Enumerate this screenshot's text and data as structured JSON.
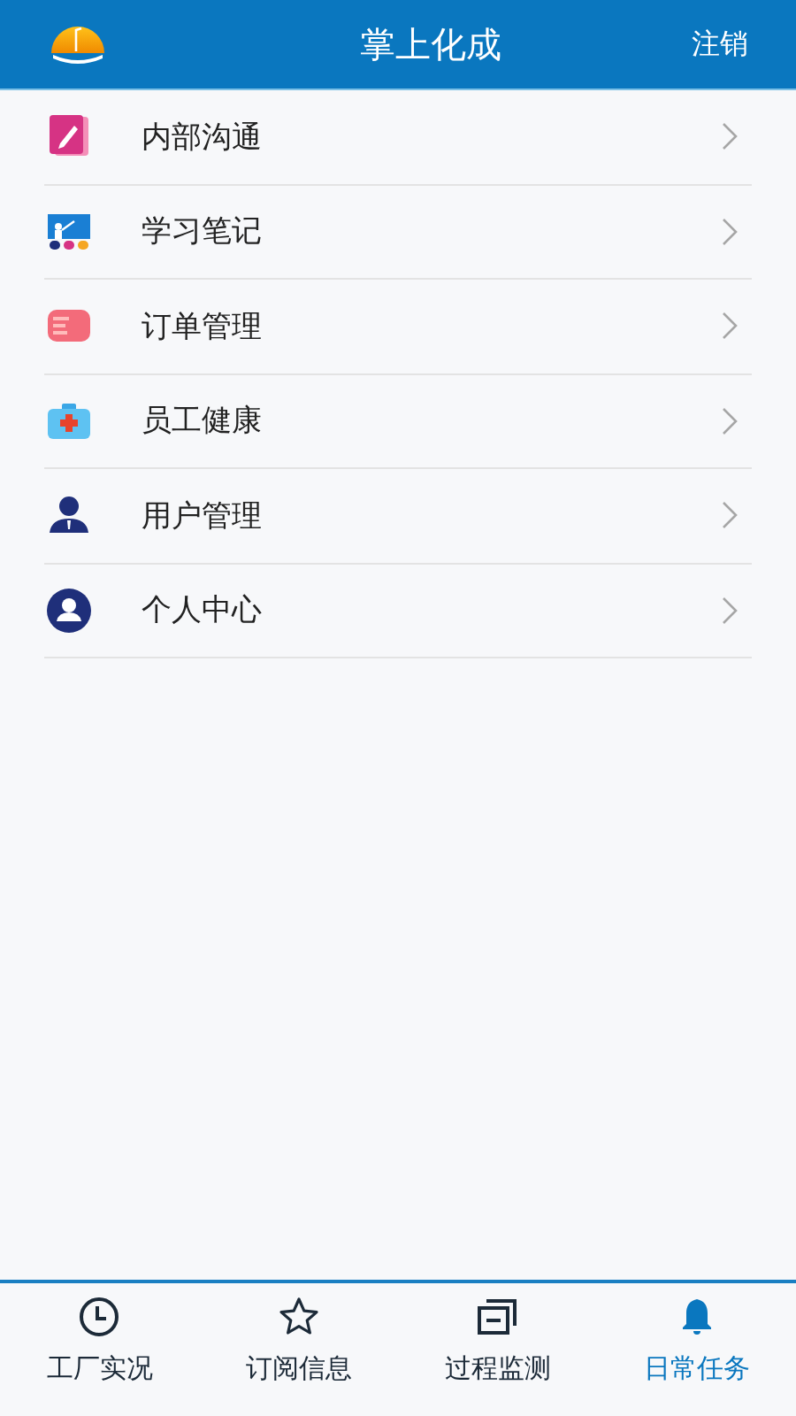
{
  "header": {
    "title": "掌上化成",
    "action": "注销"
  },
  "menu": [
    {
      "label": "内部沟通"
    },
    {
      "label": "学习笔记"
    },
    {
      "label": "订单管理"
    },
    {
      "label": "员工健康"
    },
    {
      "label": "用户管理"
    },
    {
      "label": "个人中心"
    }
  ],
  "tabs": [
    {
      "label": "工厂实况",
      "selected": false
    },
    {
      "label": "订阅信息",
      "selected": false
    },
    {
      "label": "过程监测",
      "selected": false
    },
    {
      "label": "日常任务",
      "selected": true
    }
  ]
}
